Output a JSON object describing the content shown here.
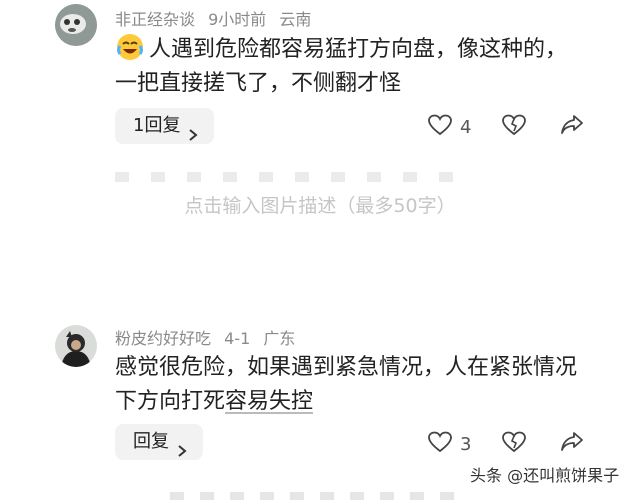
{
  "comments": [
    {
      "username": "非正经杂谈",
      "time": "9小时前",
      "location": "云南",
      "emoji": "laughing-crying-emoji",
      "text": "人遇到危险都容易猛打方向盘，像这种的，一把直接搓飞了，不侧翻才怪",
      "reply_label": "1回复",
      "likes": "4"
    },
    {
      "username": "粉皮约好好吃",
      "time": "4-1",
      "location": "广东",
      "text_before": "感觉很危险，如果遇到紧急情况，人在紧张情况下方向打死",
      "text_underlined": "容易失控",
      "reply_label": "回复",
      "likes": "3"
    }
  ],
  "photo_caption": "点击输入图片描述（最多50字）",
  "watermark": "头条 @还叫煎饼果子",
  "colors": {
    "meta": "#8a8a8a",
    "caption": "#c6c6c6",
    "reply_bg": "#f2f2f2"
  }
}
